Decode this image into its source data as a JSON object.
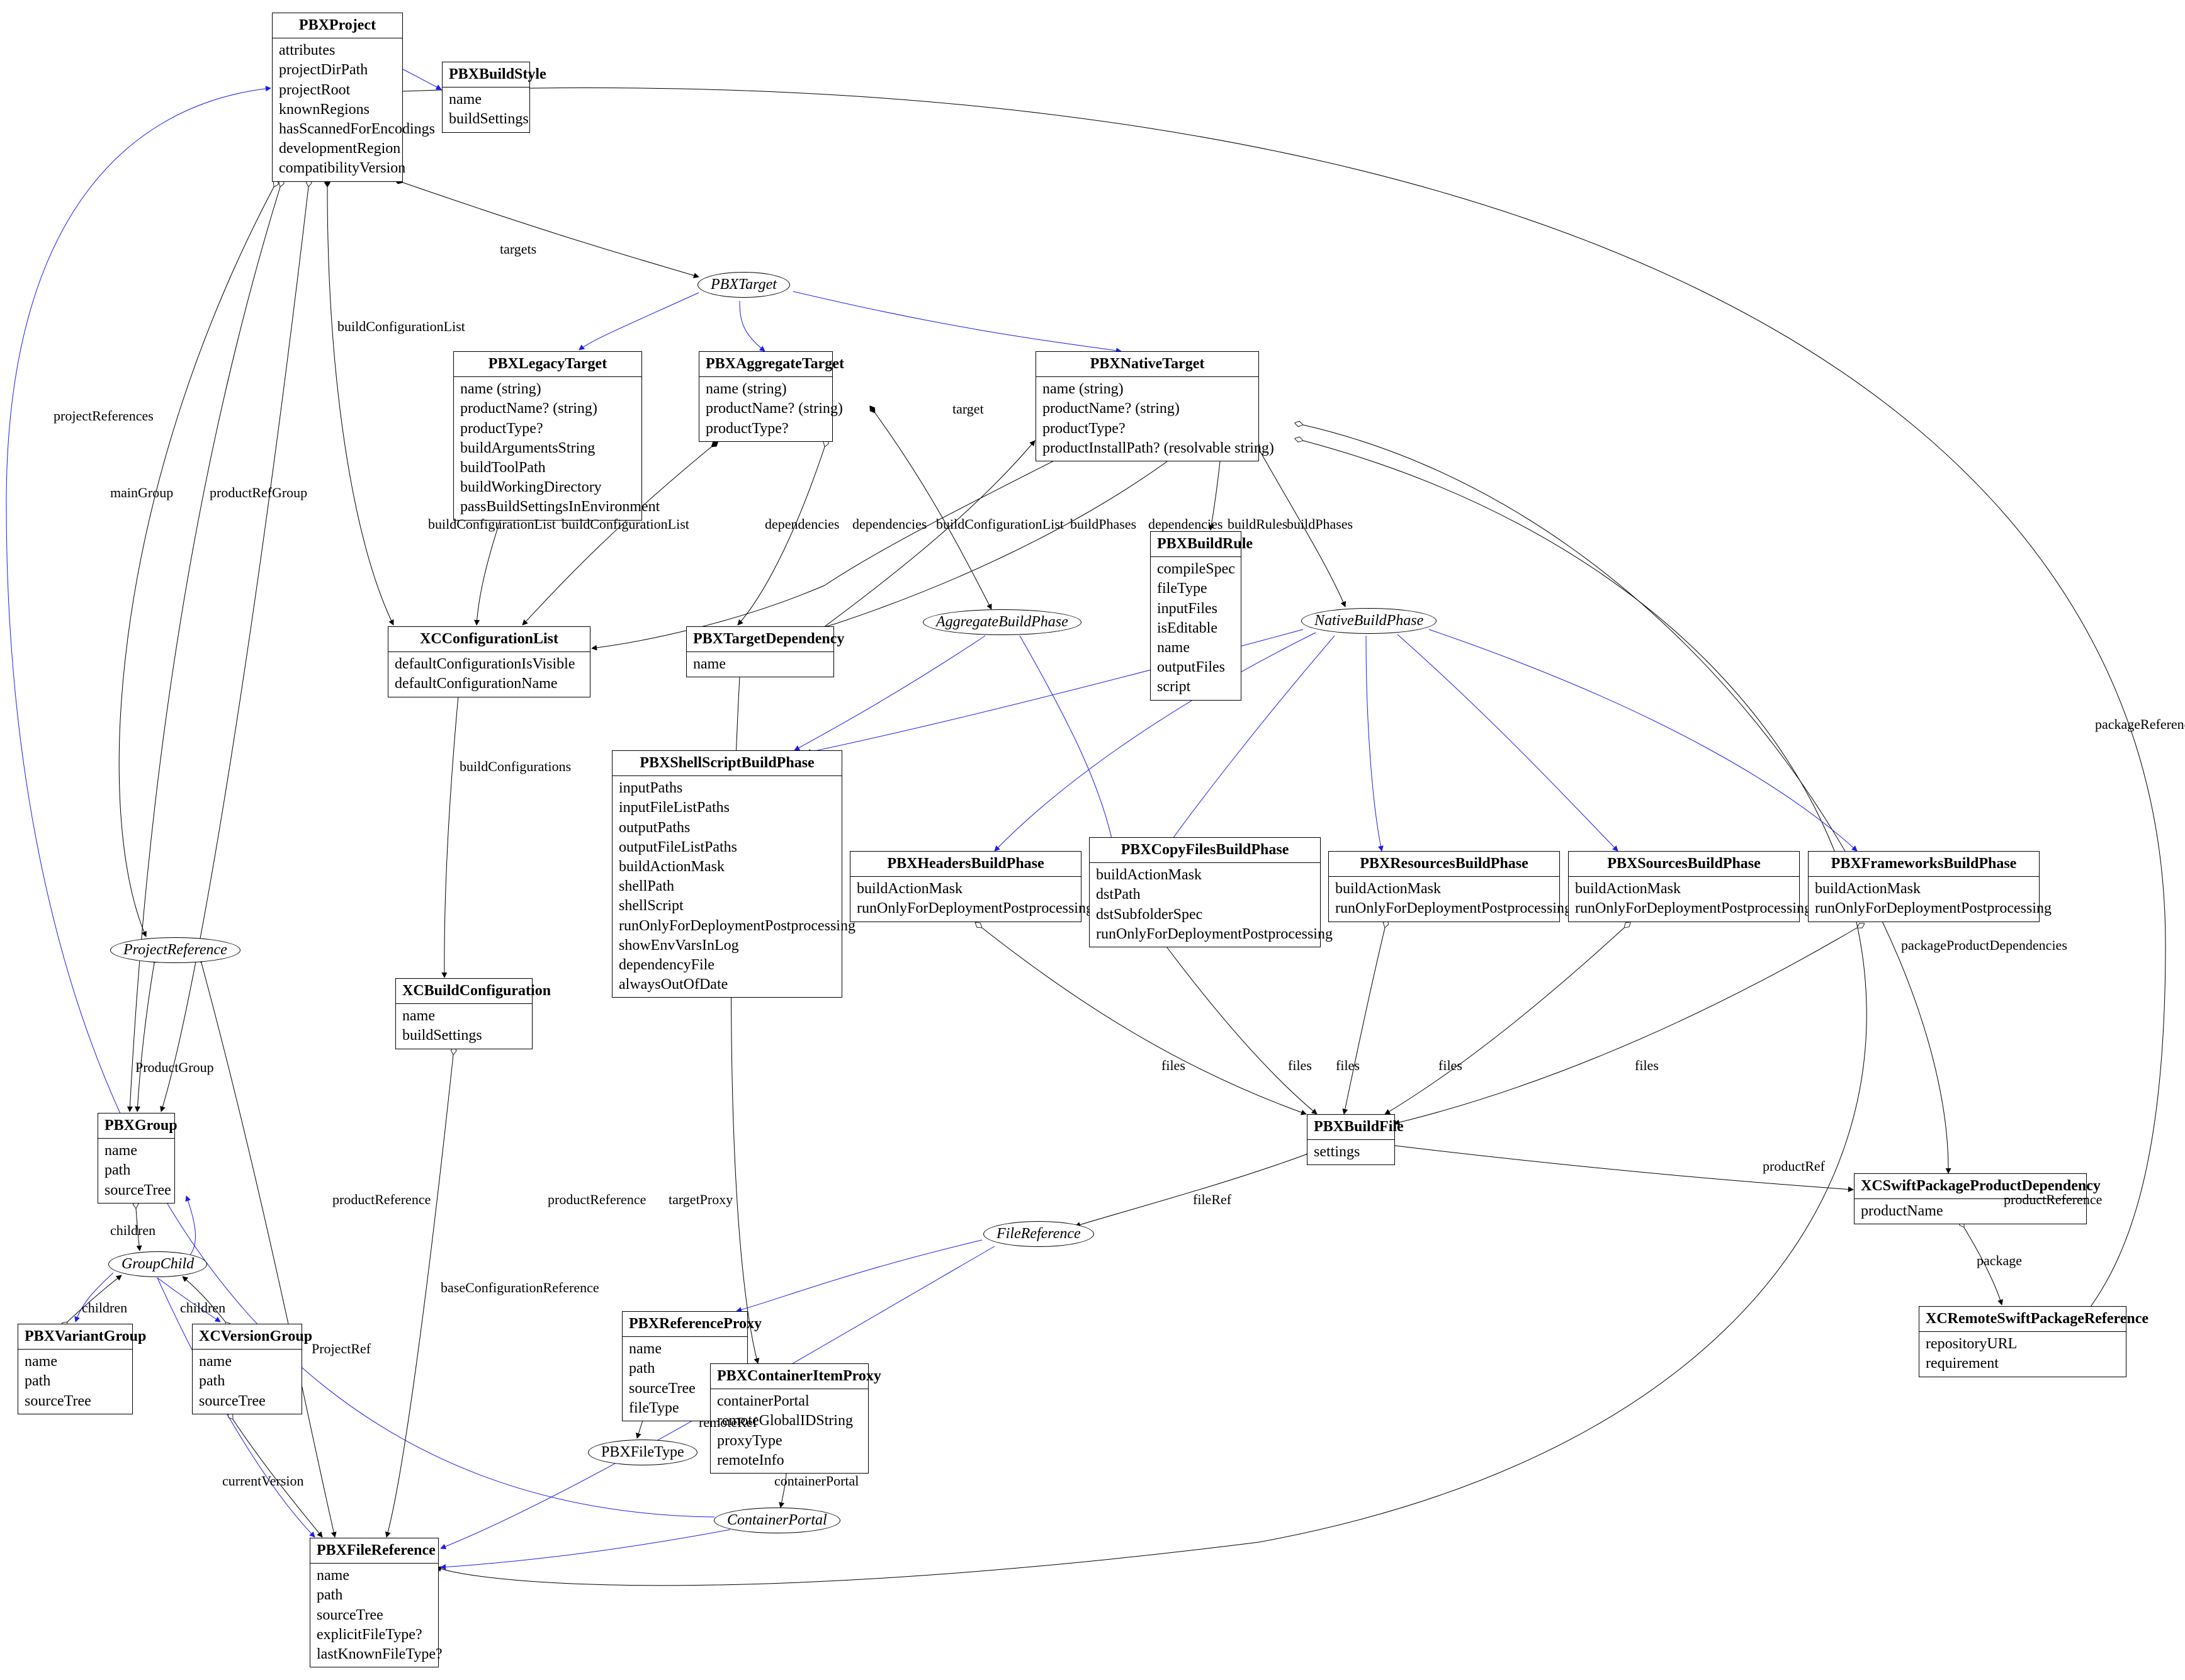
{
  "nodes": {
    "PBXProject": {
      "title": "PBXProject",
      "attrs": [
        "attributes",
        "projectDirPath",
        "projectRoot",
        "knownRegions",
        "hasScannedForEncodings",
        "developmentRegion",
        "compatibilityVersion"
      ]
    },
    "PBXBuildStyle": {
      "title": "PBXBuildStyle",
      "attrs": [
        "name",
        "buildSettings"
      ]
    },
    "PBXLegacyTarget": {
      "title": "PBXLegacyTarget",
      "attrs": [
        "name (string)",
        "productName? (string)",
        "productType?",
        "buildArgumentsString",
        "buildToolPath",
        "buildWorkingDirectory",
        "passBuildSettingsInEnvironment"
      ]
    },
    "PBXAggregateTarget": {
      "title": "PBXAggregateTarget",
      "attrs": [
        "name (string)",
        "productName? (string)",
        "productType?"
      ]
    },
    "PBXNativeTarget": {
      "title": "PBXNativeTarget",
      "attrs": [
        "name (string)",
        "productName? (string)",
        "productType?",
        "productInstallPath? (resolvable string)"
      ]
    },
    "XCConfigurationList": {
      "title": "XCConfigurationList",
      "attrs": [
        "defaultConfigurationIsVisible",
        "defaultConfigurationName"
      ]
    },
    "PBXTargetDependency": {
      "title": "PBXTargetDependency",
      "attrs": [
        "name"
      ]
    },
    "PBXBuildRule": {
      "title": "PBXBuildRule",
      "attrs": [
        "compileSpec",
        "fileType",
        "inputFiles",
        "isEditable",
        "name",
        "outputFiles",
        "script"
      ]
    },
    "PBXShellScriptBuildPhase": {
      "title": "PBXShellScriptBuildPhase",
      "attrs": [
        "inputPaths",
        "inputFileListPaths",
        "outputPaths",
        "outputFileListPaths",
        "buildActionMask",
        "shellPath",
        "shellScript",
        "runOnlyForDeploymentPostprocessing",
        "showEnvVarsInLog",
        "dependencyFile",
        "alwaysOutOfDate"
      ]
    },
    "PBXHeadersBuildPhase": {
      "title": "PBXHeadersBuildPhase",
      "attrs": [
        "buildActionMask",
        "runOnlyForDeploymentPostprocessing"
      ]
    },
    "PBXCopyFilesBuildPhase": {
      "title": "PBXCopyFilesBuildPhase",
      "attrs": [
        "buildActionMask",
        "dstPath",
        "dstSubfolderSpec",
        "runOnlyForDeploymentPostprocessing"
      ]
    },
    "PBXResourcesBuildPhase": {
      "title": "PBXResourcesBuildPhase",
      "attrs": [
        "buildActionMask",
        "runOnlyForDeploymentPostprocessing"
      ]
    },
    "PBXSourcesBuildPhase": {
      "title": "PBXSourcesBuildPhase",
      "attrs": [
        "buildActionMask",
        "runOnlyForDeploymentPostprocessing"
      ]
    },
    "PBXFrameworksBuildPhase": {
      "title": "PBXFrameworksBuildPhase",
      "attrs": [
        "buildActionMask",
        "runOnlyForDeploymentPostprocessing"
      ]
    },
    "XCBuildConfiguration": {
      "title": "XCBuildConfiguration",
      "attrs": [
        "name",
        "buildSettings"
      ]
    },
    "PBXBuildFile": {
      "title": "PBXBuildFile",
      "attrs": [
        "settings"
      ]
    },
    "XCSwiftPackageProductDependency": {
      "title": "XCSwiftPackageProductDependency",
      "attrs": [
        "productName"
      ]
    },
    "XCRemoteSwiftPackageReference": {
      "title": "XCRemoteSwiftPackageReference",
      "attrs": [
        "repositoryURL",
        "requirement"
      ]
    },
    "PBXGroup": {
      "title": "PBXGroup",
      "attrs": [
        "name",
        "path",
        "sourceTree"
      ]
    },
    "PBXVariantGroup": {
      "title": "PBXVariantGroup",
      "attrs": [
        "name",
        "path",
        "sourceTree"
      ]
    },
    "XCVersionGroup": {
      "title": "XCVersionGroup",
      "attrs": [
        "name",
        "path",
        "sourceTree"
      ]
    },
    "PBXReferenceProxy": {
      "title": "PBXReferenceProxy",
      "attrs": [
        "name",
        "path",
        "sourceTree",
        "fileType"
      ]
    },
    "PBXContainerItemProxy": {
      "title": "PBXContainerItemProxy",
      "attrs": [
        "containerPortal",
        "remoteGlobalIDString",
        "proxyType",
        "remoteInfo"
      ]
    },
    "PBXFileReference": {
      "title": "PBXFileReference",
      "attrs": [
        "name",
        "path",
        "sourceTree",
        "explicitFileType?",
        "lastKnownFileType?"
      ]
    }
  },
  "ellipses": {
    "PBXTarget": "PBXTarget",
    "AggregateBuildPhase": "AggregateBuildPhase",
    "NativeBuildPhase": "NativeBuildPhase",
    "ProjectReference": "ProjectReference",
    "GroupChild": "GroupChild",
    "FileReference": "FileReference",
    "ContainerPortal": "ContainerPortal",
    "PBXFileType": "PBXFileType"
  },
  "edgeLabels": {
    "targets": "targets",
    "buildConfigurationList": "buildConfigurationList",
    "mainGroup": "mainGroup",
    "productRefGroup": "productRefGroup",
    "projectReferences": "projectReferences",
    "packageReferences": "packageReferences",
    "packageProductDependencies": "packageProductDependencies",
    "target": "target",
    "dependencies": "dependencies",
    "buildPhases": "buildPhases",
    "buildRules": "buildRules",
    "buildConfigurations": "buildConfigurations",
    "files": "files",
    "fileRef": "fileRef",
    "productRef": "productRef",
    "package": "package",
    "children": "children",
    "currentVersion": "currentVersion",
    "ProjectRef": "ProjectRef",
    "baseConfigurationReference": "baseConfigurationReference",
    "targetProxy": "targetProxy",
    "productReference": "productReference",
    "remoteRef": "remoteRef",
    "containerPortal": "containerPortal",
    "ProductGroup": "ProductGroup"
  }
}
